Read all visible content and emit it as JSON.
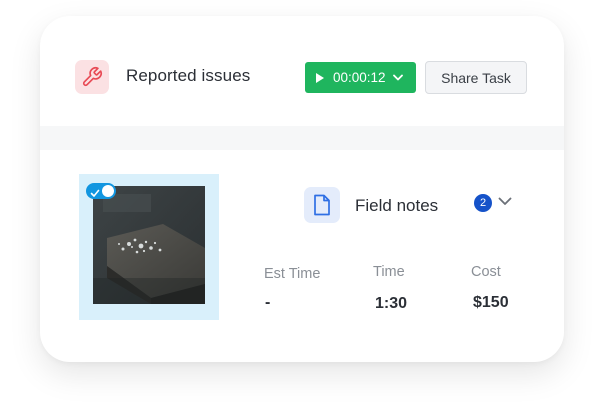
{
  "task": {
    "title": "Reported issues",
    "title_icon": "wrench-icon",
    "timer_label": "00:00:12",
    "share_label": "Share Task"
  },
  "attachment": {
    "notes_label": "Field notes",
    "notes_icon": "document-icon",
    "notes_count": "2",
    "photo_selected": true
  },
  "stats": {
    "est_time_label": "Est Time",
    "est_time_value": "-",
    "time_label": "Time",
    "time_value": "1:30",
    "cost_label": "Cost",
    "cost_value": "$150"
  },
  "colors": {
    "timer_green": "#1fb55e",
    "wrench_red": "#e84a55",
    "toggle_blue": "#1296e0",
    "badge_blue": "#1552c9",
    "doc_blue": "#2f6fe4"
  }
}
